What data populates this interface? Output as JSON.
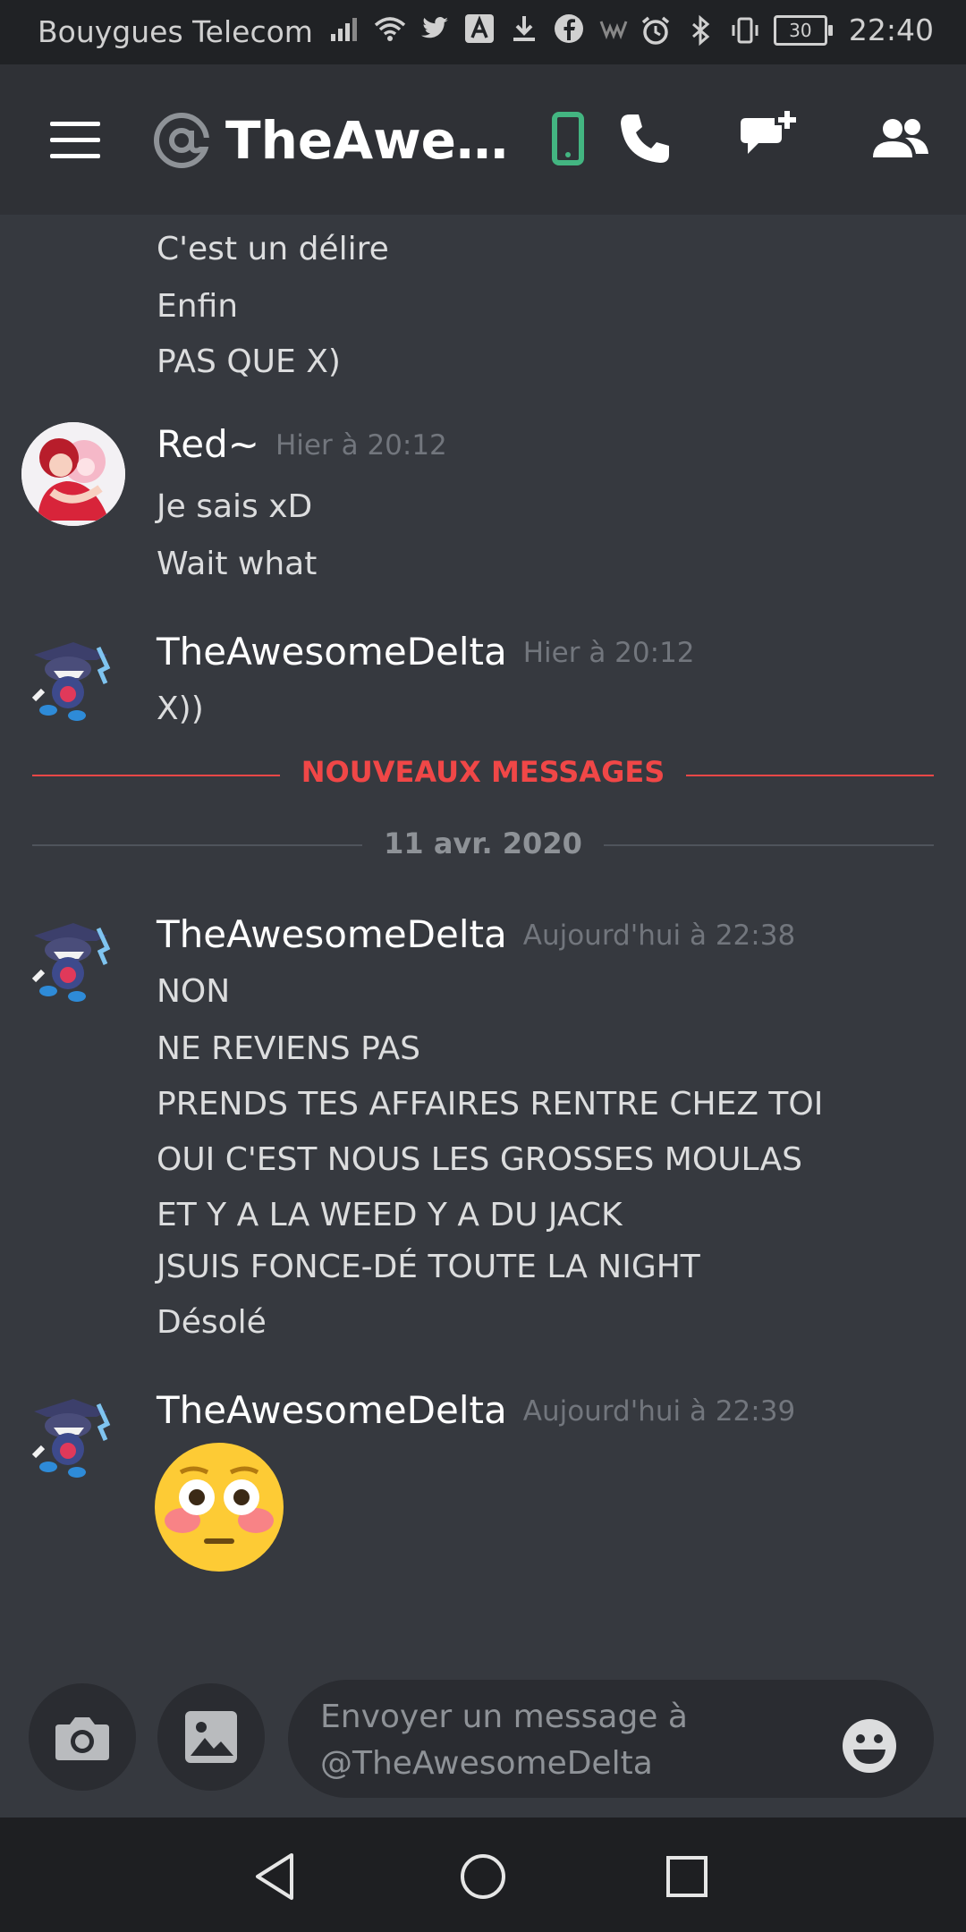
{
  "status_bar": {
    "carrier": "Bouygues Telecom",
    "battery": "30",
    "time": "22:40"
  },
  "header": {
    "at_symbol": "@",
    "title": "TheAwesomeDelta",
    "accent_color": "#43b581"
  },
  "messages": {
    "continuation": [
      "C'est un délire",
      "Enfin",
      "PAS QUE X)"
    ],
    "groups": [
      {
        "author": "Red~",
        "timestamp": "Hier à 20:12",
        "lines": [
          "Je sais xD",
          "Wait what"
        ]
      },
      {
        "author": "TheAwesomeDelta",
        "timestamp": "Hier à 20:12",
        "lines": [
          "X))"
        ]
      },
      {
        "author": "TheAwesomeDelta",
        "timestamp": "Aujourd'hui à 22:38",
        "lines": [
          "NON",
          "NE REVIENS PAS",
          "PRENDS TES AFFAIRES RENTRE CHEZ TOI",
          "OUI C'EST NOUS LES GROSSES MOULAS",
          "ET Y A LA WEED Y A DU JACK",
          "JSUIS FONCE-DÉ TOUTE LA NIGHT",
          "Désolé"
        ]
      },
      {
        "author": "TheAwesomeDelta",
        "timestamp": "Aujourd'hui à 22:39",
        "emoji": "flushed-face"
      }
    ],
    "new_messages_label": "NOUVEAUX MESSAGES",
    "new_messages_color": "#f04747",
    "date_label": "11 avr. 2020"
  },
  "composer": {
    "placeholder_line1": "Envoyer un message à",
    "placeholder_line2": "@TheAwesomeDelta"
  }
}
